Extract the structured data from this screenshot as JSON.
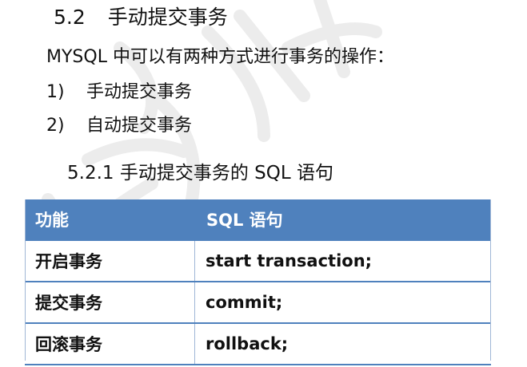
{
  "section": {
    "number": "5.2",
    "title": "手动提交事务"
  },
  "intro": "MYSQL 中可以有两种方式进行事务的操作：",
  "list": [
    {
      "marker": "1)",
      "text": "手动提交事务"
    },
    {
      "marker": "2)",
      "text": "自动提交事务"
    }
  ],
  "subsection": {
    "title": "5.2.1 手动提交事务的 SQL 语句"
  },
  "table": {
    "headers": [
      "功能",
      "SQL 语句"
    ],
    "rows": [
      [
        "开启事务",
        "start transaction;"
      ],
      [
        "提交事务",
        "commit;"
      ],
      [
        "回滚事务",
        "rollback;"
      ]
    ]
  },
  "colors": {
    "header_bg": "#4f81bd",
    "header_text": "#ffffff",
    "watermark": "#e6e6e6"
  }
}
